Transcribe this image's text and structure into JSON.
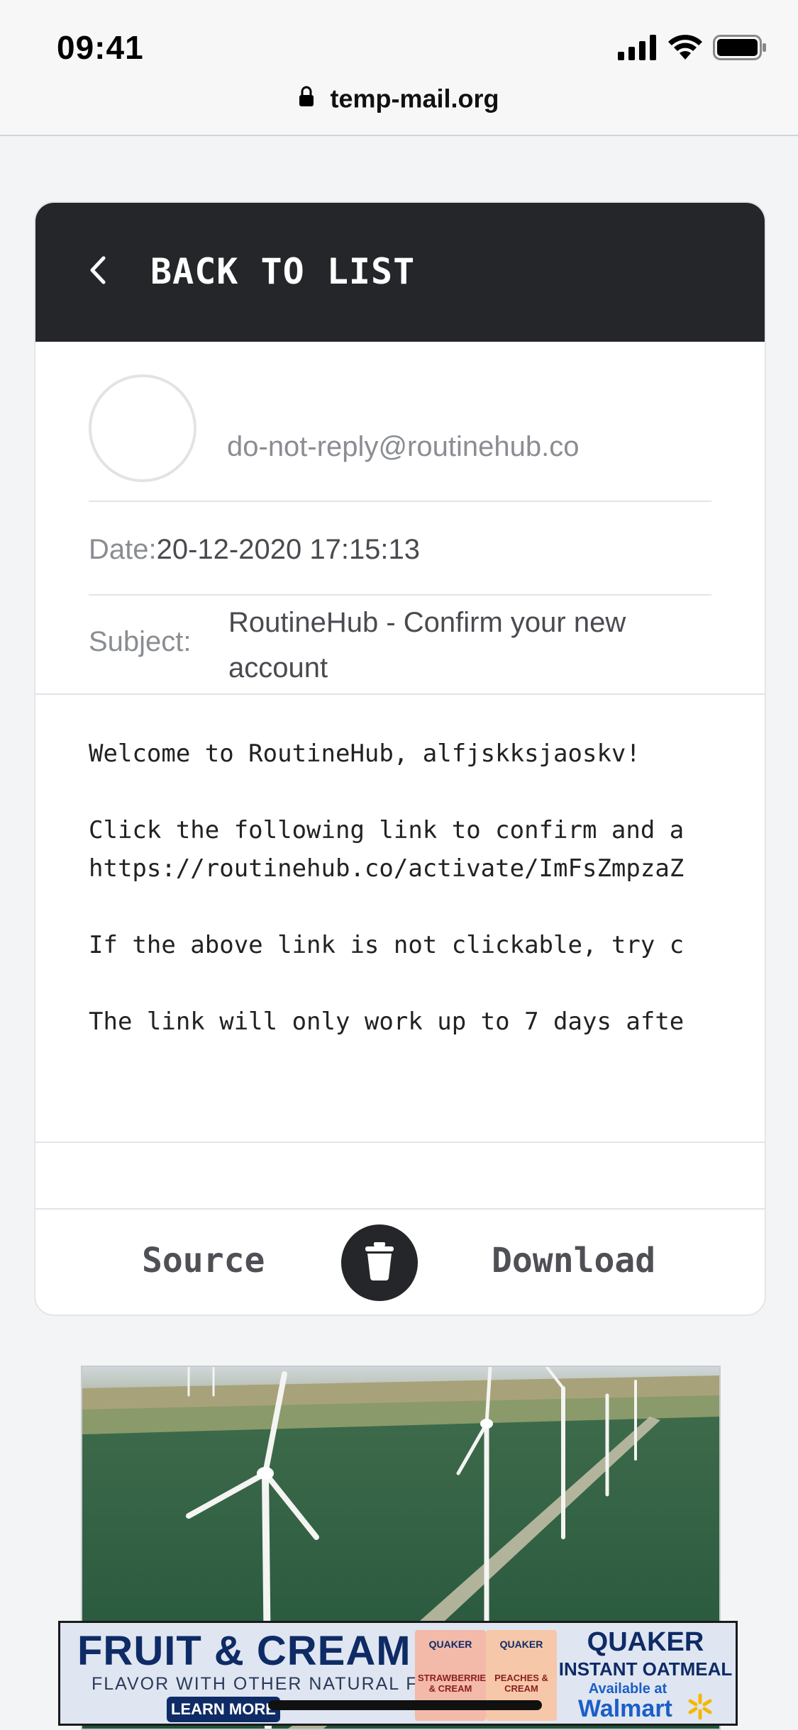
{
  "status_bar": {
    "time": "09:41"
  },
  "browser": {
    "url": "temp-mail.org"
  },
  "header": {
    "back_label": "BACK TO LIST"
  },
  "email": {
    "sender": "do-not-reply@routinehub.co",
    "date_label": "Date:",
    "date_value": "20-12-2020 17:15:13",
    "subject_label": "Subject:",
    "subject_value": "RoutineHub - Confirm your new account",
    "body": "Welcome to RoutineHub, alfjskksjaoskv!\n\nClick the following link to confirm and a\nhttps://routinehub.co/activate/ImFsZmpzaZ\n\nIf the above link is not clickable, try c\n\nThe link will only work up to 7 days afte"
  },
  "actions": {
    "source_label": "Source",
    "download_label": "Download"
  },
  "banner_ad": {
    "title": "FRUIT & CREAM",
    "subtitle": "FLAVOR WITH OTHER NATURAL FLAVORS",
    "cta": "LEARN MORE",
    "box1_brand": "QUAKER",
    "box1_label": "STRAWBERRIES & CREAM",
    "box2_brand": "QUAKER",
    "box2_label": "PEACHES & CREAM",
    "brand": "QUAKER",
    "product": "INSTANT OATMEAL",
    "availability": "Available at",
    "store": "Walmart"
  },
  "colors": {
    "header_bg": "#25262a",
    "muted_text": "#8a8d92",
    "body_text": "#4a4b50",
    "brand_blue": "#0f2b66"
  },
  "icons": [
    "signal-icon",
    "wifi-icon",
    "battery-icon",
    "lock-icon",
    "chevron-left-icon",
    "trash-icon",
    "walmart-spark-icon"
  ]
}
